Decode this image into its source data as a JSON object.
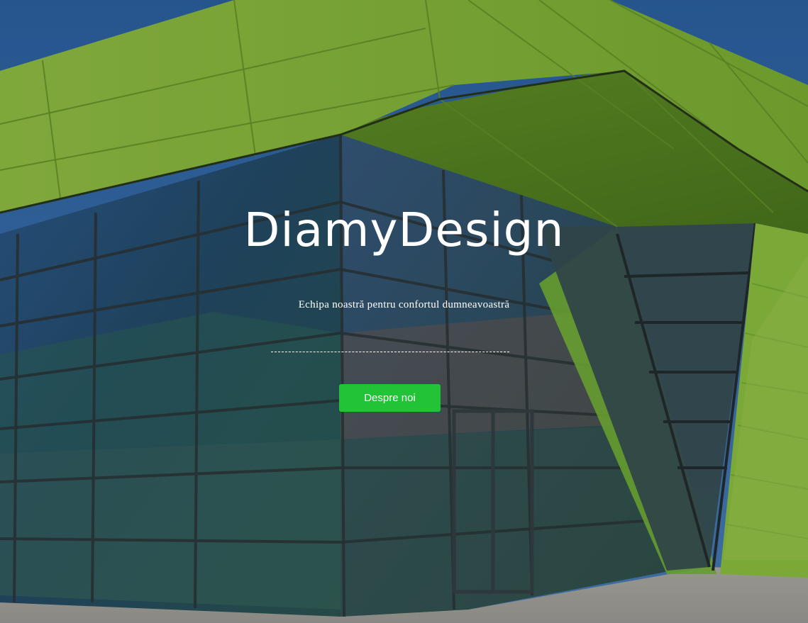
{
  "hero": {
    "title": "DiamyDesign",
    "tagline": "Echipa noastră pentru confortul dumneavoastră",
    "cta_label": "Despre noi"
  },
  "colors": {
    "cta_background": "#22c337",
    "facade_green": "#8cc63f",
    "sky_blue": "#3a6fa8",
    "text": "#ffffff"
  }
}
